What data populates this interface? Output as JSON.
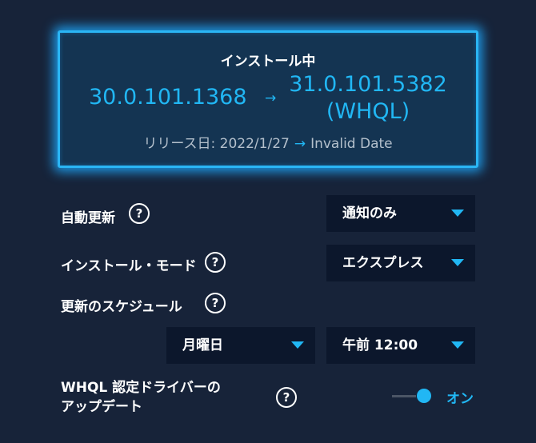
{
  "install_card": {
    "title": "インストール中",
    "current_version": "30.0.101.1368",
    "arrow": "→",
    "new_version_line1": "31.0.101.5382",
    "new_version_line2": "(WHQL)",
    "release_label": "リリース日: 2022/1/27",
    "release_arrow": "→",
    "release_new": "Invalid Date"
  },
  "settings": {
    "auto_update": {
      "label": "自動更新",
      "help": "?",
      "value": "通知のみ"
    },
    "install_mode": {
      "label": "インストール・モード",
      "help": "?",
      "value": "エクスプレス"
    },
    "schedule": {
      "label": "更新のスケジュール",
      "help": "?",
      "day": "月曜日",
      "time": "午前 12:00"
    },
    "whql": {
      "label_line1": "WHQL 認定ドライバーの",
      "label_line2": "アップデート",
      "help": "?",
      "toggle_label": "オン",
      "toggle_on": true
    }
  },
  "colors": {
    "accent": "#21b7f4",
    "background": "#172339",
    "card": "#143452",
    "select_bg": "#0c172c"
  }
}
